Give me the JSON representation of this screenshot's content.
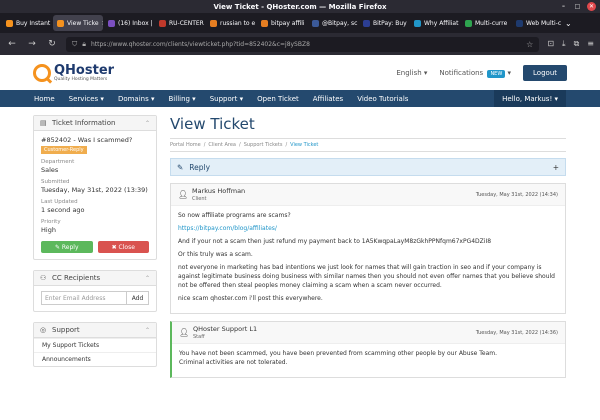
{
  "browser": {
    "window_title": "View Ticket - QHoster.com — Mozilla Firefox",
    "tabs": [
      {
        "label": "Buy Instant H",
        "color": "#f5921e"
      },
      {
        "label": "View Ticke",
        "color": "#f5921e",
        "active": true
      },
      {
        "label": "(16) Inbox |",
        "color": "#7b4fc0"
      },
      {
        "label": "RU-CENTER",
        "color": "#c0392b"
      },
      {
        "label": "russian to e",
        "color": "#e67e22"
      },
      {
        "label": "bitpay affili",
        "color": "#e67e22"
      },
      {
        "label": "@Bitpay, sc",
        "color": "#3b5998"
      },
      {
        "label": "BitPay: Buy",
        "color": "#2c3e93"
      },
      {
        "label": "Why Affiliat",
        "color": "#2196c9"
      },
      {
        "label": "Multi-curre",
        "color": "#2ea44f"
      },
      {
        "label": "Web Multi-c",
        "color": "#1e3a6e"
      }
    ],
    "tab_overflow": "⌄",
    "url": "https://www.qhoster.com/clients/viewticket.php?tid=852402&c=j8ySBZ8"
  },
  "site": {
    "logo_name": "QHoster",
    "logo_tagline": "Quality Hosting Matters",
    "language": "English ▾",
    "notifications": "Notifications",
    "new_badge": "NEW",
    "logout": "Logout",
    "nav": [
      "Home",
      "Services ▾",
      "Domains ▾",
      "Billing ▾",
      "Support ▾",
      "Open Ticket",
      "Affiliates",
      "Video Tutorials"
    ],
    "hello": "Hello, Markus! ▾"
  },
  "sidebar": {
    "ticket_info_title": "Ticket Information",
    "ticket_subject": "#852402 - Was I scammed?",
    "ticket_status": "Customer-Reply",
    "department_label": "Department",
    "department": "Sales",
    "submitted_label": "Submitted",
    "submitted": "Tuesday, May 31st, 2022 (13:39)",
    "last_updated_label": "Last Updated",
    "last_updated": "1 second ago",
    "priority_label": "Priority",
    "priority": "High",
    "reply_btn": "✎ Reply",
    "close_btn": "✖ Close",
    "cc_title": "CC Recipients",
    "cc_placeholder": "Enter Email Address",
    "cc_add": "Add",
    "support_title": "Support",
    "support_items": [
      "My Support Tickets",
      "Announcements"
    ]
  },
  "main": {
    "title": "View Ticket",
    "breadcrumb": [
      "Portal Home",
      "/",
      "Client Area",
      "/",
      "Support Tickets",
      "/",
      "View Ticket"
    ],
    "reply_label": "Reply",
    "reply_toggle": "+",
    "messages": [
      {
        "author": "Markus Hoffman",
        "role": "Client",
        "date": "Tuesday, May 31st, 2022 (14:34)",
        "paragraphs": [
          "So now affiliate programs are scams?",
          "https://bitpay.com/blog/affiliates/",
          "And if your not a scam then just refund my payment back to 1A5KwqpaLayM8zGkhPPNfqm67xPG4DZiI8",
          "Or this truly was a scam.",
          "not everyone in marketing has bad intentions we just look for names that will gain traction in seo and if your company is against legitimate business doing business with similar names then you should not even offer names that you believe should not be offered then steal peoples money claiming a scam when a scam never occurred.",
          "nice scam qhoster.com i'll post this everywhere."
        ]
      },
      {
        "author": "QHoster Support L1",
        "role": "Staff",
        "date": "Tuesday, May 31st, 2022 (14:36)",
        "paragraphs": [
          "You have not been scammed, you have been prevented from scamming other people by our Abuse Team.",
          "Criminal activities are not tolerated."
        ]
      }
    ]
  }
}
